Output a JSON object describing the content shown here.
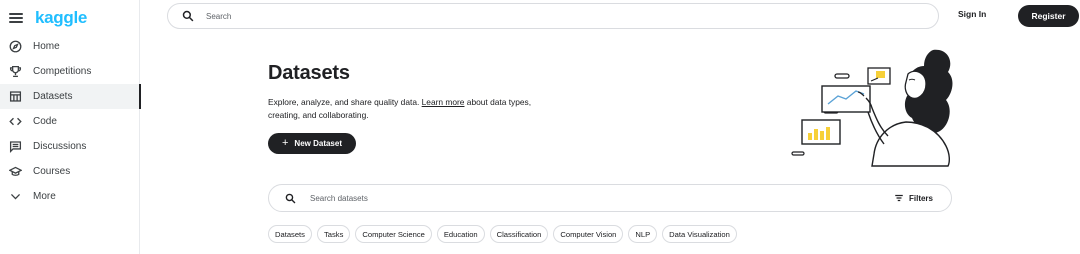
{
  "brand": {
    "logo_text": "kaggle",
    "color": "#20beff"
  },
  "sidebar": {
    "items": [
      {
        "label": "Home",
        "icon": "compass-icon"
      },
      {
        "label": "Competitions",
        "icon": "trophy-icon"
      },
      {
        "label": "Datasets",
        "icon": "table-icon",
        "active": true
      },
      {
        "label": "Code",
        "icon": "code-icon"
      },
      {
        "label": "Discussions",
        "icon": "comment-icon"
      },
      {
        "label": "Courses",
        "icon": "graduation-cap-icon"
      },
      {
        "label": "More",
        "icon": "chevron-down-icon"
      }
    ]
  },
  "header": {
    "search_placeholder": "Search",
    "signin_label": "Sign In",
    "register_label": "Register"
  },
  "hero": {
    "title": "Datasets",
    "description_prefix": "Explore, analyze, and share quality data. ",
    "learn_more_link": "Learn more",
    "description_suffix": " about data types, creating, and collaborating.",
    "new_dataset_label": "New Dataset",
    "new_dataset_icon": "plus-icon"
  },
  "dataset_search": {
    "placeholder": "Search datasets",
    "filters_label": "Filters"
  },
  "chips": [
    "Datasets",
    "Tasks",
    "Computer Science",
    "Education",
    "Classification",
    "Computer Vision",
    "NLP",
    "Data Visualization"
  ],
  "colors": {
    "primary_dark": "#202124",
    "border": "#dadce0",
    "accent_yellow": "#f7d038"
  }
}
